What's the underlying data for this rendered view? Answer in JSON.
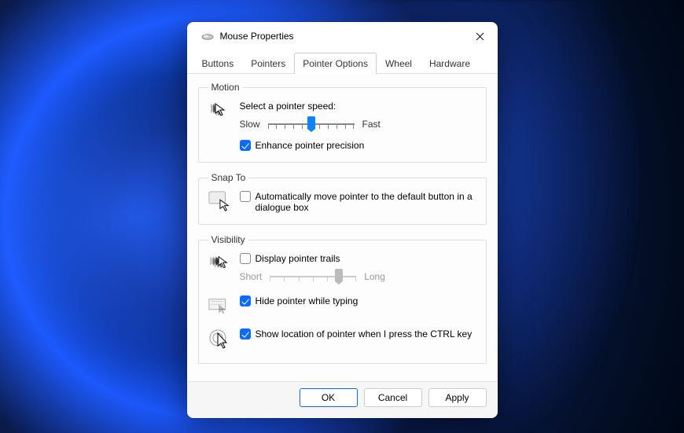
{
  "window": {
    "title": "Mouse Properties"
  },
  "tabs": [
    "Buttons",
    "Pointers",
    "Pointer Options",
    "Wheel",
    "Hardware"
  ],
  "activeTab": "Pointer Options",
  "motion": {
    "legend": "Motion",
    "prompt": "Select a pointer speed:",
    "slow": "Slow",
    "fast": "Fast",
    "speedPercent": 50,
    "enhance": {
      "label": "Enhance pointer precision",
      "checked": true
    }
  },
  "snap": {
    "legend": "Snap To",
    "auto": {
      "label": "Automatically move pointer to the default button in a dialogue box",
      "checked": false
    }
  },
  "visibility": {
    "legend": "Visibility",
    "trails": {
      "label": "Display pointer trails",
      "checked": false,
      "short": "Short",
      "long": "Long",
      "percent": 80
    },
    "hide": {
      "label": "Hide pointer while typing",
      "checked": true
    },
    "ctrl": {
      "label": "Show location of pointer when I press the CTRL key",
      "checked": true
    }
  },
  "buttons": {
    "ok": "OK",
    "cancel": "Cancel",
    "apply": "Apply"
  }
}
